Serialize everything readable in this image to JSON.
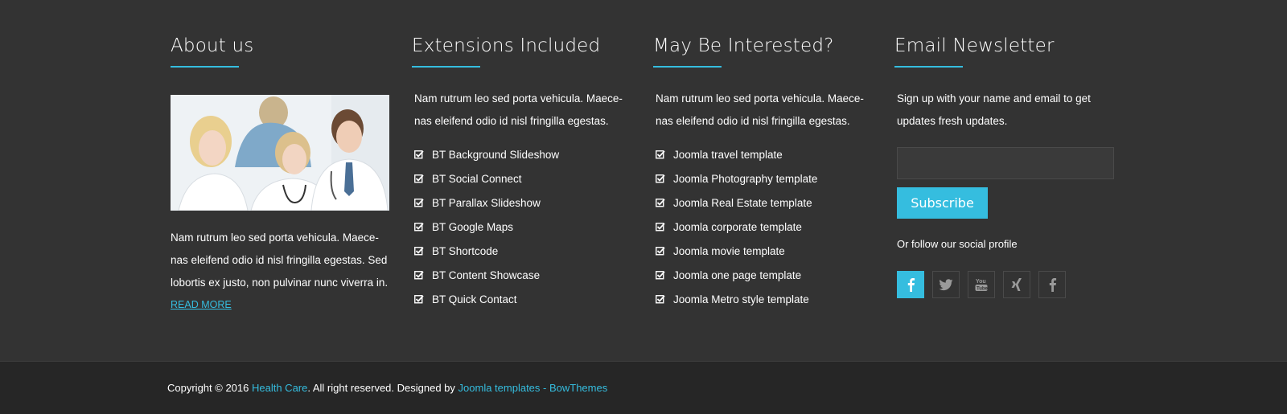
{
  "about": {
    "title": "About us",
    "text": "Nam rutrum leo sed porta vehicula. Maece-nas eleifend odio id nisl fringilla egestas. Sed lobortis ex justo, non pulvinar nunc viverra in.",
    "read_more": "READ MORE"
  },
  "extensions": {
    "title": "Extensions Included",
    "text": "Nam rutrum leo sed porta vehicula. Maece-nas eleifend odio id nisl fringilla egestas.",
    "items": [
      "BT Background Slideshow",
      "BT Social Connect",
      "BT Parallax Slideshow",
      "BT Google Maps",
      "BT Shortcode",
      "BT Content Showcase",
      "BT Quick Contact"
    ]
  },
  "interested": {
    "title": "May Be Interested?",
    "text": "Nam rutrum leo sed porta vehicula. Maece-nas eleifend odio id nisl fringilla egestas.",
    "items": [
      "Joomla travel template",
      "Joomla Photography template",
      "Joomla Real Estate template",
      "Joomla corporate template",
      "Joomla movie template",
      "Joomla one page template",
      "Joomla Metro style template"
    ]
  },
  "newsletter": {
    "title": "Email Newsletter",
    "text": "Sign up with your name and email to get updates fresh updates.",
    "email_value": "",
    "subscribe_label": "Subscribe",
    "follow_text": "Or follow our social profile",
    "social": [
      "facebook-icon",
      "twitter-icon",
      "youtube-icon",
      "xing-icon",
      "facebook-icon"
    ]
  },
  "copyright": {
    "prefix": "Copyright © 2016",
    "site": "Health Care",
    "middle": ". All right reserved. Designed by",
    "designer": "Joomla templates - BowThemes"
  },
  "colors": {
    "accent": "#35bddf",
    "background": "#333333",
    "bottom_bar": "#262626"
  }
}
